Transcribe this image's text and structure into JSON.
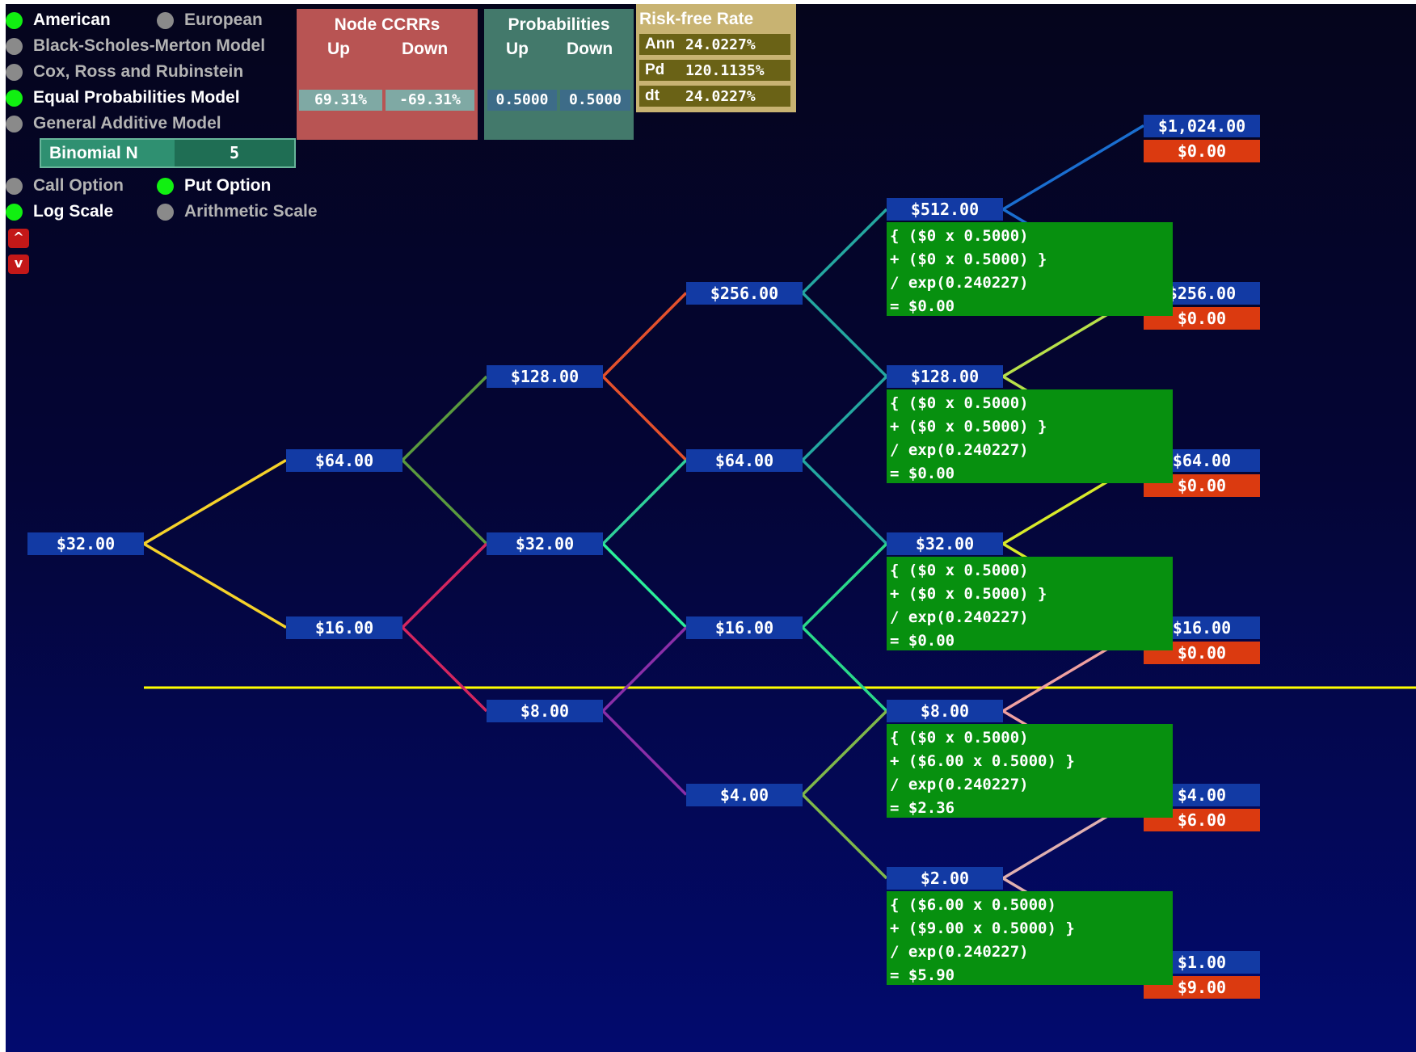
{
  "exercise": {
    "american": "American",
    "european": "European",
    "selected": "american"
  },
  "models": [
    {
      "label": "Black-Scholes-Merton Model",
      "selected": false
    },
    {
      "label": "Cox, Ross and Rubinstein",
      "selected": false
    },
    {
      "label": "Equal Probabilities Model",
      "selected": true
    },
    {
      "label": "General Additive Model",
      "selected": false
    }
  ],
  "binomial": {
    "label": "Binomial N",
    "value": "5"
  },
  "option_type": {
    "call": "Call Option",
    "put": "Put Option",
    "selected": "put"
  },
  "scale": {
    "log": "Log Scale",
    "arithmetic": "Arithmetic Scale",
    "selected": "log"
  },
  "arrows": {
    "up": "^",
    "down": "v"
  },
  "ccrr_panel": {
    "title": "Node CCRRs",
    "up_label": "Up",
    "down_label": "Down",
    "up_value": "69.31%",
    "down_value": "-69.31%"
  },
  "prob_panel": {
    "title": "Probabilities",
    "up_label": "Up",
    "down_label": "Down",
    "up_value": "0.5000",
    "down_value": "0.5000"
  },
  "rate_panel": {
    "title": "Risk-free Rate",
    "rows": [
      {
        "key": "Ann",
        "value": "24.0227%"
      },
      {
        "key": "Pd",
        "value": "120.1135%"
      },
      {
        "key": "dt",
        "value": "24.0227%"
      }
    ]
  },
  "colors": {
    "up_dot": "#11f011",
    "off_dot": "#8a8a8a",
    "price_box": "#123aa4",
    "payoff_box": "#db3a10",
    "calc_box": "#07900f",
    "strike_line": "#ffff00"
  },
  "tree": {
    "levels": [
      [
        "$32.00"
      ],
      [
        "$64.00",
        "$16.00"
      ],
      [
        "$128.00",
        "$32.00",
        "$8.00"
      ],
      [
        "$256.00",
        "$64.00",
        "$16.00",
        "$4.00"
      ],
      [
        "$512.00",
        "$128.00",
        "$32.00",
        "$8.00",
        "$2.00"
      ],
      [
        "$1,024.00",
        "$256.00",
        "$64.00",
        "$16.00",
        "$4.00",
        "$1.00"
      ]
    ],
    "terminal_payoffs": [
      "$0.00",
      "$0.00",
      "$0.00",
      "$0.00",
      "$6.00",
      "$9.00"
    ],
    "calculations": [
      {
        "l1": "{ ($0 x 0.5000)",
        "l2": "+ ($0 x 0.5000) }",
        "l3": "/ exp(0.240227)",
        "l4": "= $0.00"
      },
      {
        "l1": "{ ($0 x 0.5000)",
        "l2": "+ ($0 x 0.5000) }",
        "l3": "/ exp(0.240227)",
        "l4": "= $0.00"
      },
      {
        "l1": "{ ($0 x 0.5000)",
        "l2": "+ ($0 x 0.5000) }",
        "l3": "/ exp(0.240227)",
        "l4": "= $0.00"
      },
      {
        "l1": "{ ($0 x 0.5000)",
        "l2": "+ ($6.00 x 0.5000) }",
        "l3": "/ exp(0.240227)",
        "l4": "= $2.36"
      },
      {
        "l1": "{ ($6.00 x 0.5000)",
        "l2": "+ ($9.00 x 0.5000) }",
        "l3": "/ exp(0.240227)",
        "l4": "= $5.90"
      }
    ]
  }
}
